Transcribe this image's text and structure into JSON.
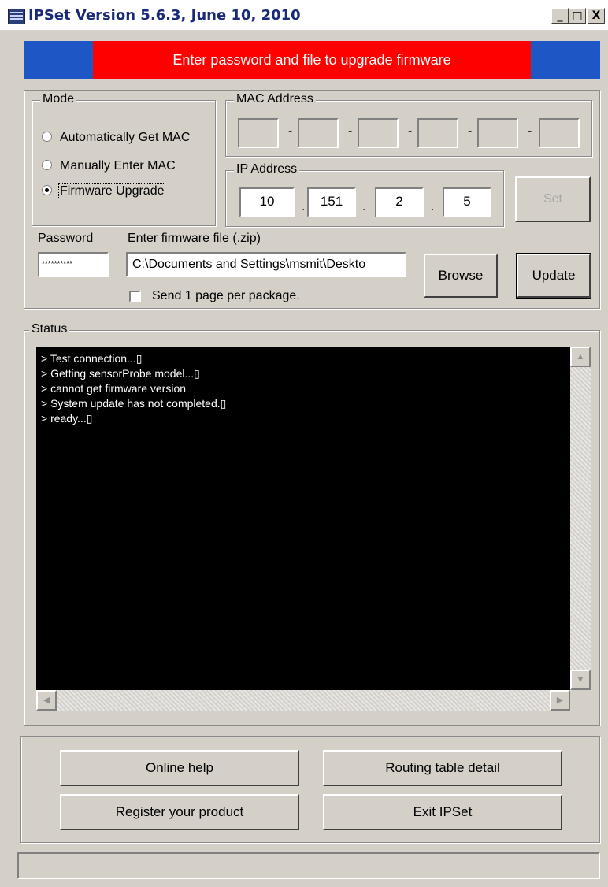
{
  "window": {
    "title": "IPSet Version 5.6.3,  June 10, 2010",
    "controls": {
      "minimize": "_",
      "maximize": "□",
      "close": "X"
    }
  },
  "banner": {
    "message": "Enter password and file to upgrade firmware",
    "colors": {
      "side": "#1f56c6",
      "center": "#fe0000"
    }
  },
  "mode": {
    "title": "Mode",
    "options": [
      {
        "label": "Automatically Get MAC",
        "selected": false
      },
      {
        "label": "Manually Enter MAC",
        "selected": false
      },
      {
        "label": "Firmware Upgrade",
        "selected": true
      }
    ]
  },
  "mac": {
    "title": "MAC Address",
    "octets": [
      "",
      "",
      "",
      "",
      "",
      ""
    ],
    "separator": "-"
  },
  "ip": {
    "title": "IP Address",
    "octets": [
      "10",
      "151",
      "2",
      "5"
    ],
    "separator": "."
  },
  "set_button": "Set",
  "password": {
    "label": "Password",
    "value": "**********"
  },
  "firmware": {
    "label": "Enter firmware file (.zip)",
    "value": "C:\\Documents and Settings\\msmit\\Deskto"
  },
  "browse_button": "Browse",
  "update_button": "Update",
  "send_page": {
    "label": "Send 1 page per package.",
    "checked": false
  },
  "status": {
    "title": "Status",
    "lines": [
      "> Test connection...▯",
      "> Getting sensorProbe model...▯",
      "> cannot get firmware version",
      "> System update has not completed.▯",
      "> ready...▯"
    ]
  },
  "buttons": {
    "online_help": "Online help",
    "routing_table": "Routing table detail",
    "register": "Register your product",
    "exit": "Exit IPSet"
  },
  "statusbar_text": ""
}
